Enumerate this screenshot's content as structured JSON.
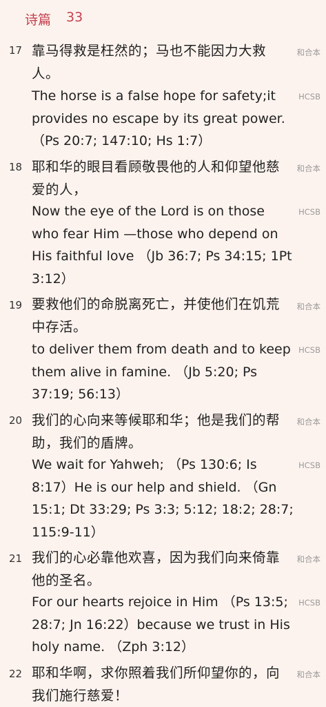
{
  "header": {
    "book": "诗篇",
    "chapter": "33"
  },
  "verses": [
    {
      "num": "17",
      "cn": "靠马得救是枉然的；马也不能因力大救人。",
      "cn_version": "和合本",
      "en": "The horse is a false hope for safety;it provides no escape by its great power. （Ps 20:7; 147:10; Hs 1:7）",
      "en_version": "HCSB"
    },
    {
      "num": "18",
      "cn": "耶和华的眼目看顾敬畏他的人和仰望他慈爱的人，",
      "cn_version": "和合本",
      "en": "Now the eye of the Lord is on those who fear Him —those who depend on His faithful love （Jb 36:7; Ps 34:15; 1Pt 3:12）",
      "en_version": "HCSB"
    },
    {
      "num": "19",
      "cn": "要救他们的命脱离死亡，并使他们在饥荒中存活。",
      "cn_version": "和合本",
      "en": "to deliver them from death and to keep them alive in famine. （Jb 5:20; Ps 37:19; 56:13）",
      "en_version": "HCSB"
    },
    {
      "num": "20",
      "cn": "我们的心向来等候耶和华；他是我们的帮助，我们的盾牌。",
      "cn_version": "和合本",
      "en": "We wait for Yahweh; （Ps 130:6; Is 8:17）He is our help and shield. （Gn 15:1; Dt 33:29; Ps 3:3; 5:12; 18:2; 28:7; 115:9-11）",
      "en_version": "HCSB"
    },
    {
      "num": "21",
      "cn": "我们的心必靠他欢喜，因为我们向来倚靠他的圣名。",
      "cn_version": "和合本",
      "en": "For our hearts rejoice in Him （Ps 13:5; 28:7; Jn 16:22）because we trust in His holy name. （Zph 3:12）",
      "en_version": "HCSB"
    },
    {
      "num": "22",
      "cn": "耶和华啊，求你照着我们所仰望你的，向我们施行慈爱！",
      "cn_version": "和合本"
    }
  ]
}
